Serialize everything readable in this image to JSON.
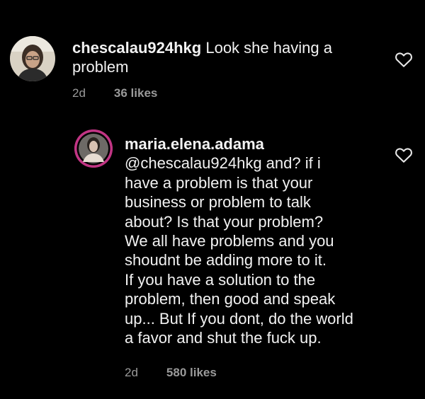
{
  "comments": [
    {
      "username": "chescalau924hkg",
      "text": " Look she having a\nproblem",
      "time": "2d",
      "likes": "36 likes",
      "avatar_icon": "profile-avatar"
    },
    {
      "username": "maria.elena.adama",
      "text": "@chescalau924hkg and? if i\nhave a problem is that your\nbusiness or problem to talk\nabout? Is that your problem?\nWe all have problems and you\nshoudnt be adding more to it.\nIf you have a solution to the\nproblem, then good and speak\nup... But If you dont, do the world\na favor and shut the fuck up.",
      "time": "2d",
      "likes": "580 likes",
      "avatar_icon": "profile-avatar-story-ring"
    }
  ],
  "colors": {
    "background": "#000000",
    "text": "#f2f2f2",
    "meta": "#9a9a9a",
    "story_ring": "#c13584"
  }
}
